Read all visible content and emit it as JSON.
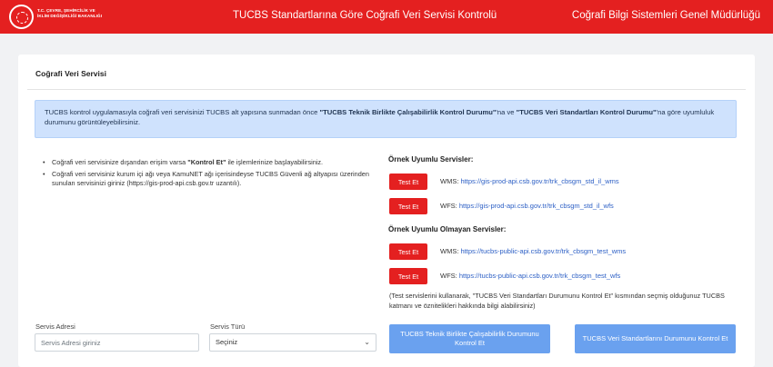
{
  "header": {
    "ministry_lines": [
      "T.C. ÇEVRE, ŞEHİRCİLİK VE",
      "İKLİM DEĞİŞİKLİĞİ BAKANLIĞI"
    ],
    "title": "TUCBS Standartlarına Göre Coğrafi Veri Servisi Kontrolü",
    "org_name": "Coğrafi Bilgi Sistemleri Genel Müdürlüğü",
    "brand_color": "#e42020"
  },
  "card": {
    "title": "Coğrafi Veri Servisi",
    "info": {
      "text_1": "TUCBS kontrol uygulamasıyla coğrafi veri servisinizi TUCBS alt yapısına sunmadan önce ",
      "bold_1": "\"TUCBS Teknik Birlikte Çalışabilirlik Kontrol Durumu\"",
      "text_2": "'na ve ",
      "bold_2": "\"TUCBS Veri Standartları Kontrol Durumu\"",
      "text_3": "'na göre uyumluluk durumunu görüntüleyebilirsiniz."
    },
    "bullets": {
      "item1_a": "Coğrafi veri servisinize dışarıdan erişim varsa ",
      "item1_bold": "\"Kontrol Et\"",
      "item1_b": " ile işlemlerinize başlayabilirsiniz.",
      "item2": "Coğrafi veri servisiniz kurum içi ağı veya KamuNET ağı içerisindeyse TUCBS Güvenli ağ altyapısı üzerinden sunulan servisinizi giriniz (https://gis-prod-api.csb.gov.tr uzantılı)."
    },
    "compliant": {
      "heading": "Örnek Uyumlu Servisler:",
      "items": [
        {
          "button": "Test Et",
          "type": "WMS:",
          "url": "https://gis-prod-api.csb.gov.tr/trk_cbsgm_std_il_wms"
        },
        {
          "button": "Test Et",
          "type": "WFS:",
          "url": "https://gis-prod-api.csb.gov.tr/trk_cbsgm_std_il_wfs"
        }
      ]
    },
    "noncompliant": {
      "heading": "Örnek Uyumlu Olmayan Servisler:",
      "items": [
        {
          "button": "Test Et",
          "type": "WMS:",
          "url": "https://tucbs-public-api.csb.gov.tr/trk_cbsgm_test_wms"
        },
        {
          "button": "Test Et",
          "type": "WFS:",
          "url": "https://tucbs-public-api.csb.gov.tr/trk_cbsgm_test_wfs"
        }
      ]
    },
    "note": "(Test servislerini kullanarak, \"TUCBS Veri Standartları Durumunu Kontrol Et\" kısmından seçmiş olduğunuz TUCBS katmanı ve öznitelikleri hakkında bilgi alabilirsiniz)",
    "form": {
      "address_label": "Servis Adresi",
      "address_placeholder": "Servis Adresi giriniz",
      "type_label": "Servis Türü",
      "type_selected": "Seçiniz"
    },
    "actions": {
      "tech_check": "TUCBS Teknik Birlikte Çalışabilirlik Durumunu Kontrol Et",
      "data_check": "TUCBS Veri Standartlarını Durumunu Kontrol Et"
    }
  }
}
